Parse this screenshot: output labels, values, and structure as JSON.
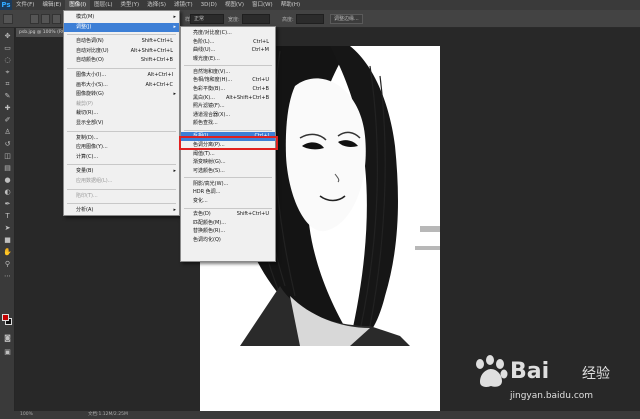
{
  "app": {
    "logo": "Ps"
  },
  "menubar": {
    "items": [
      {
        "label": "文件(F)"
      },
      {
        "label": "编辑(E)"
      },
      {
        "label": "图像(I)",
        "active": true
      },
      {
        "label": "图层(L)"
      },
      {
        "label": "类型(Y)"
      },
      {
        "label": "选择(S)"
      },
      {
        "label": "滤镜(T)"
      },
      {
        "label": "3D(D)"
      },
      {
        "label": "视图(V)"
      },
      {
        "label": "窗口(W)"
      },
      {
        "label": "帮助(H)"
      }
    ]
  },
  "options": {
    "style_label": "样式:",
    "style_value": "正常",
    "width_label": "宽度:",
    "height_label": "高度:",
    "refine_button": "调整边缘..."
  },
  "document": {
    "tab_label": "psb.jpg @ 100% (RG..."
  },
  "status": {
    "zoom": "100%",
    "doc_info": "文档:1.12M/2.25M"
  },
  "image_menu": {
    "items": [
      {
        "label": "模式(M)",
        "sub": true
      },
      {
        "label": "调整(J)",
        "sub": true,
        "highlight": true
      },
      {
        "sep": true
      },
      {
        "label": "自动色调(N)",
        "shortcut": "Shift+Ctrl+L"
      },
      {
        "label": "自动对比度(U)",
        "shortcut": "Alt+Shift+Ctrl+L"
      },
      {
        "label": "自动颜色(O)",
        "shortcut": "Shift+Ctrl+B"
      },
      {
        "sep": true
      },
      {
        "label": "图像大小(I)...",
        "shortcut": "Alt+Ctrl+I"
      },
      {
        "label": "画布大小(S)...",
        "shortcut": "Alt+Ctrl+C"
      },
      {
        "label": "图像旋转(G)",
        "sub": true
      },
      {
        "label": "裁剪(P)",
        "disabled": true
      },
      {
        "label": "裁切(R)..."
      },
      {
        "label": "显示全部(V)"
      },
      {
        "sep": true
      },
      {
        "label": "复制(D)..."
      },
      {
        "label": "应用图像(Y)..."
      },
      {
        "label": "计算(C)..."
      },
      {
        "sep": true
      },
      {
        "label": "变量(B)",
        "sub": true
      },
      {
        "label": "应用数据组(L)...",
        "disabled": true
      },
      {
        "sep": true
      },
      {
        "label": "陷印(T)...",
        "disabled": true
      },
      {
        "sep": true
      },
      {
        "label": "分析(A)",
        "sub": true
      }
    ]
  },
  "adjust_menu": {
    "items": [
      {
        "label": "亮度/对比度(C)..."
      },
      {
        "label": "色阶(L)...",
        "shortcut": "Ctrl+L"
      },
      {
        "label": "曲线(U)...",
        "shortcut": "Ctrl+M"
      },
      {
        "label": "曝光度(E)..."
      },
      {
        "sep": true
      },
      {
        "label": "自然饱和度(V)..."
      },
      {
        "label": "色相/饱和度(H)...",
        "shortcut": "Ctrl+U"
      },
      {
        "label": "色彩平衡(B)...",
        "shortcut": "Ctrl+B"
      },
      {
        "label": "黑白(K)...",
        "shortcut": "Alt+Shift+Ctrl+B"
      },
      {
        "label": "照片滤镜(F)..."
      },
      {
        "label": "通道混合器(X)..."
      },
      {
        "label": "颜色查找..."
      },
      {
        "sep": true
      },
      {
        "label": "反相(I)",
        "shortcut": "Ctrl+I",
        "highlight": true
      },
      {
        "label": "色调分离(P)..."
      },
      {
        "label": "阈值(T)..."
      },
      {
        "label": "渐变映射(G)..."
      },
      {
        "label": "可选颜色(S)..."
      },
      {
        "sep": true
      },
      {
        "label": "阴影/高光(W)..."
      },
      {
        "label": "HDR 色调..."
      },
      {
        "label": "变化..."
      },
      {
        "sep": true
      },
      {
        "label": "去色(D)",
        "shortcut": "Shift+Ctrl+U"
      },
      {
        "label": "匹配颜色(M)..."
      },
      {
        "label": "替换颜色(R)..."
      },
      {
        "label": "色调均化(Q)"
      }
    ]
  },
  "watermark": {
    "brand": "Bai",
    "cn": "经验",
    "url": "jingyan.baidu.com"
  },
  "colors": {
    "highlight": "#3d7fd6",
    "callout": "#e02020",
    "foreground_swatch": "#c40000",
    "background_swatch": "#111111"
  }
}
